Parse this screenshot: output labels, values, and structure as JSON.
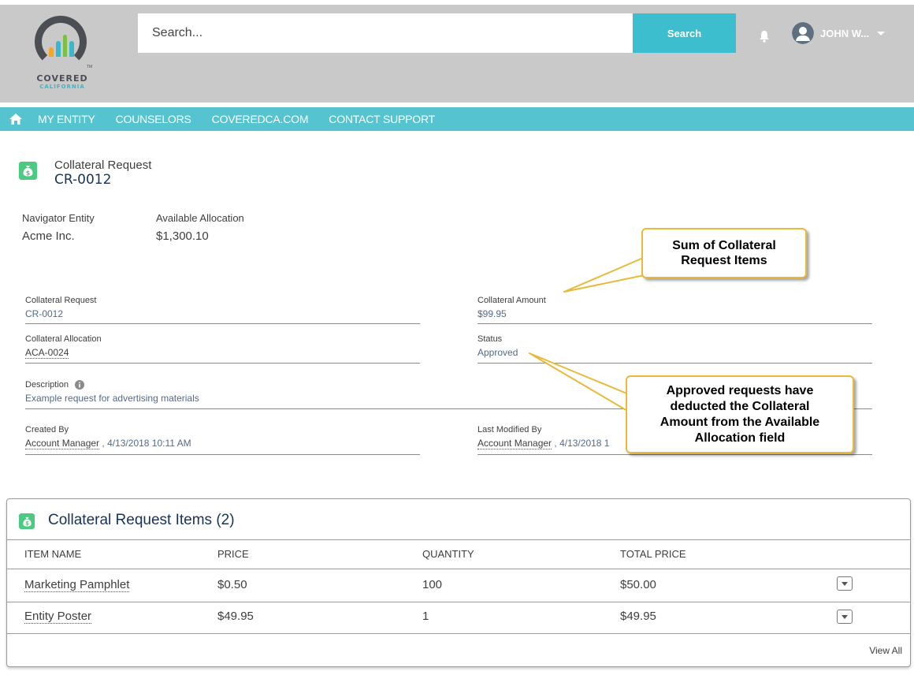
{
  "header": {
    "logo_text": "COVERED",
    "logo_subtext": "CALIFORNIA",
    "logo_tm": "TM",
    "search_placeholder": "Search...",
    "search_button": "Search",
    "user_name": "JOHN W..."
  },
  "colors": {
    "header_bg": "#c9c9c9",
    "nav_bg": "#56c3d1",
    "search_button": "#3cbecf",
    "record_icon": "#4bca81",
    "callout_border": "#e8b93a",
    "logo_bars": [
      "#f6a623",
      "#3bb7c9",
      "#7ac043",
      "#3bb7c9",
      "#f6a623"
    ]
  },
  "icons": {
    "nav_home": "home-icon",
    "notifications": "bell-icon",
    "user": "user-avatar-icon",
    "record": "money-bag-icon",
    "info": "info-icon",
    "row_menu": "chevron-down-icon"
  },
  "nav": {
    "items": [
      "MY ENTITY",
      "COUNSELORS",
      "COVEREDCA.COM",
      "CONTACT SUPPORT"
    ]
  },
  "record": {
    "type": "Collateral Request",
    "title": "CR-0012",
    "icon_glyph": "$",
    "highlights": [
      {
        "label": "Navigator Entity",
        "value": "Acme Inc."
      },
      {
        "label": "Available Allocation",
        "value": "$1,300.10"
      }
    ]
  },
  "fields": {
    "collateral_request": {
      "label": "Collateral Request",
      "value": "CR-0012"
    },
    "collateral_amount": {
      "label": "Collateral Amount",
      "value": "$99.95"
    },
    "collateral_allocation": {
      "label": "Collateral Allocation",
      "value": "ACA-0024"
    },
    "status": {
      "label": "Status",
      "value": "Approved"
    },
    "description": {
      "label": "Description",
      "value": "Example request for advertising materials"
    },
    "created_by": {
      "label": "Created By",
      "user": "Account Manager",
      "date": ", 4/13/2018 10:11 AM"
    },
    "last_modified_by": {
      "label": "Last Modified By",
      "user": "Account Manager",
      "date": ", 4/13/2018 1"
    }
  },
  "callouts": {
    "sum": {
      "line1": "Sum of Collateral",
      "line2": "Request Items"
    },
    "approved": {
      "line1": "Approved requests have",
      "line2": "deducted the Collateral",
      "line3": "Amount from the Available",
      "line4": "Allocation field"
    }
  },
  "related_list": {
    "title": "Collateral Request Items (2)",
    "columns": [
      "ITEM NAME",
      "PRICE",
      "QUANTITY",
      "TOTAL PRICE"
    ],
    "rows": [
      {
        "name": "Marketing Pamphlet",
        "price": "$0.50",
        "quantity": "100",
        "total": "$50.00"
      },
      {
        "name": "Entity Poster",
        "price": "$49.95",
        "quantity": "1",
        "total": "$49.95"
      }
    ],
    "view_all": "View All"
  }
}
